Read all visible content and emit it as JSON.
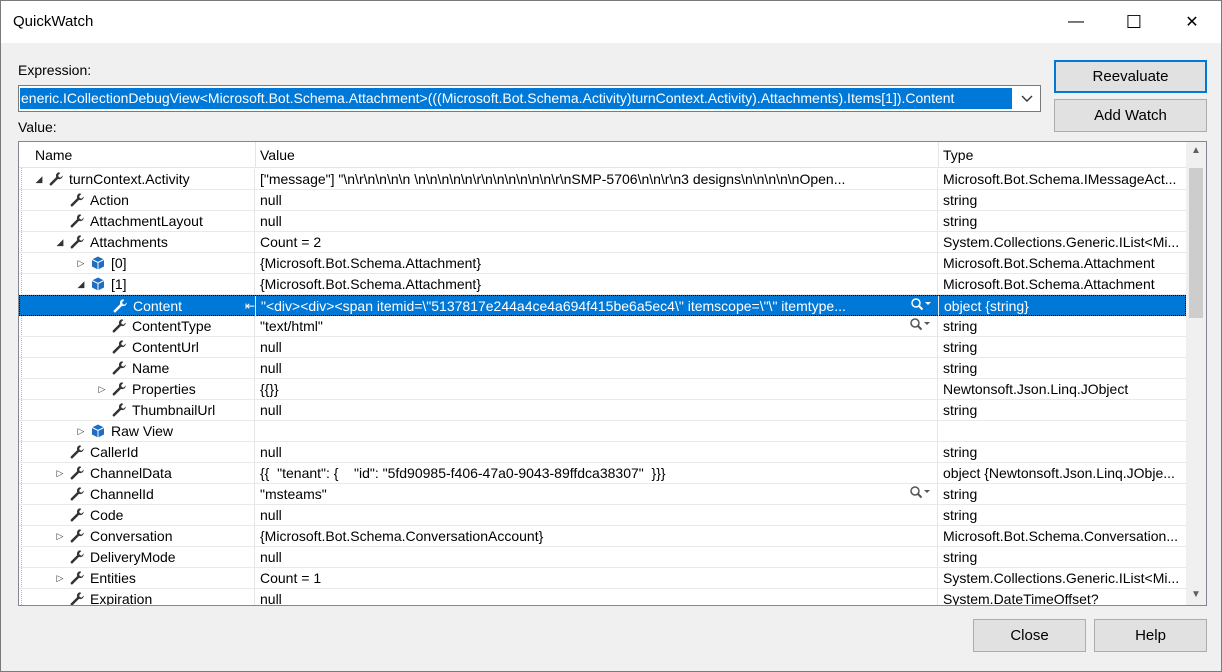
{
  "window": {
    "title": "QuickWatch",
    "minimize_glyph": "—",
    "maximize_glyph": "☐",
    "close_glyph": "✕"
  },
  "expression": {
    "label": "Expression:",
    "value": "eneric.ICollectionDebugView<Microsoft.Bot.Schema.Attachment>(((Microsoft.Bot.Schema.Activity)turnContext.Activity).Attachments).Items[1]).Content"
  },
  "value_label": "Value:",
  "buttons": {
    "reevaluate": "Reevaluate",
    "add_watch": "Add Watch",
    "close": "Close",
    "help": "Help"
  },
  "columns": {
    "name": "Name",
    "value": "Value",
    "type": "Type"
  },
  "rows": [
    {
      "indent": 0,
      "expander": "expanded",
      "icon": "wrench-icon",
      "name": "turnContext.Activity",
      "value": "[\"message\"] \"\\n\\r\\n\\n\\n\\n \\n\\n\\n\\n\\n\\r\\n\\n\\n\\n\\n\\n\\r\\nSMP-5706\\n\\n\\r\\n3 designs\\n\\n\\n\\n\\nOpen...",
      "type": "Microsoft.Bot.Schema.IMessageAct...",
      "selected": false,
      "search": false
    },
    {
      "indent": 1,
      "expander": "none",
      "icon": "wrench-icon",
      "name": "Action",
      "value": "null",
      "type": "string",
      "selected": false,
      "search": false
    },
    {
      "indent": 1,
      "expander": "none",
      "icon": "wrench-icon",
      "name": "AttachmentLayout",
      "value": "null",
      "type": "string",
      "selected": false,
      "search": false
    },
    {
      "indent": 1,
      "expander": "expanded",
      "icon": "wrench-icon",
      "name": "Attachments",
      "value": "Count = 2",
      "type": "System.Collections.Generic.IList<Mi...",
      "selected": false,
      "search": false
    },
    {
      "indent": 2,
      "expander": "collapsed",
      "icon": "cube-icon",
      "name": "[0]",
      "value": "{Microsoft.Bot.Schema.Attachment}",
      "type": "Microsoft.Bot.Schema.Attachment",
      "selected": false,
      "search": false
    },
    {
      "indent": 2,
      "expander": "expanded",
      "icon": "cube-icon",
      "name": "[1]",
      "value": "{Microsoft.Bot.Schema.Attachment}",
      "type": "Microsoft.Bot.Schema.Attachment",
      "selected": false,
      "search": false
    },
    {
      "indent": 3,
      "expander": "none",
      "icon": "wrench-icon",
      "name": "Content",
      "value": "\"<div><div><span itemid=\\\"5137817e244a4ce4a694f415be6a5ec4\\\" itemscope=\\\"\\\" itemtype...",
      "type": "object {string}",
      "selected": true,
      "search": true
    },
    {
      "indent": 3,
      "expander": "none",
      "icon": "wrench-icon",
      "name": "ContentType",
      "value": "\"text/html\"",
      "type": "string",
      "selected": false,
      "search": true
    },
    {
      "indent": 3,
      "expander": "none",
      "icon": "wrench-icon",
      "name": "ContentUrl",
      "value": "null",
      "type": "string",
      "selected": false,
      "search": false
    },
    {
      "indent": 3,
      "expander": "none",
      "icon": "wrench-icon",
      "name": "Name",
      "value": "null",
      "type": "string",
      "selected": false,
      "search": false
    },
    {
      "indent": 3,
      "expander": "collapsed",
      "icon": "wrench-icon",
      "name": "Properties",
      "value": "{{}}",
      "type": "Newtonsoft.Json.Linq.JObject",
      "selected": false,
      "search": false
    },
    {
      "indent": 3,
      "expander": "none",
      "icon": "wrench-icon",
      "name": "ThumbnailUrl",
      "value": "null",
      "type": "string",
      "selected": false,
      "search": false
    },
    {
      "indent": 2,
      "expander": "collapsed",
      "icon": "cube-icon",
      "name": "Raw View",
      "value": "",
      "type": "",
      "selected": false,
      "search": false
    },
    {
      "indent": 1,
      "expander": "none",
      "icon": "wrench-icon",
      "name": "CallerId",
      "value": "null",
      "type": "string",
      "selected": false,
      "search": false
    },
    {
      "indent": 1,
      "expander": "collapsed",
      "icon": "wrench-icon",
      "name": "ChannelData",
      "value": "{{  \"tenant\": {    \"id\": \"5fd90985-f406-47a0-9043-89ffdca38307\"  }}}",
      "type": "object {Newtonsoft.Json.Linq.JObje...",
      "selected": false,
      "search": false
    },
    {
      "indent": 1,
      "expander": "none",
      "icon": "wrench-icon",
      "name": "ChannelId",
      "value": "\"msteams\"",
      "type": "string",
      "selected": false,
      "search": true
    },
    {
      "indent": 1,
      "expander": "none",
      "icon": "wrench-icon",
      "name": "Code",
      "value": "null",
      "type": "string",
      "selected": false,
      "search": false
    },
    {
      "indent": 1,
      "expander": "collapsed",
      "icon": "wrench-icon",
      "name": "Conversation",
      "value": "{Microsoft.Bot.Schema.ConversationAccount}",
      "type": "Microsoft.Bot.Schema.Conversation...",
      "selected": false,
      "search": false
    },
    {
      "indent": 1,
      "expander": "none",
      "icon": "wrench-icon",
      "name": "DeliveryMode",
      "value": "null",
      "type": "string",
      "selected": false,
      "search": false
    },
    {
      "indent": 1,
      "expander": "collapsed",
      "icon": "wrench-icon",
      "name": "Entities",
      "value": "Count = 1",
      "type": "System.Collections.Generic.IList<Mi...",
      "selected": false,
      "search": false
    },
    {
      "indent": 1,
      "expander": "none",
      "icon": "wrench-icon",
      "name": "Expiration",
      "value": "null",
      "type": "System.DateTimeOffset?",
      "selected": false,
      "search": false
    }
  ],
  "colors": {
    "selection": "#0078d7",
    "cube": "#1e6fc2",
    "wrench": "#333333"
  }
}
